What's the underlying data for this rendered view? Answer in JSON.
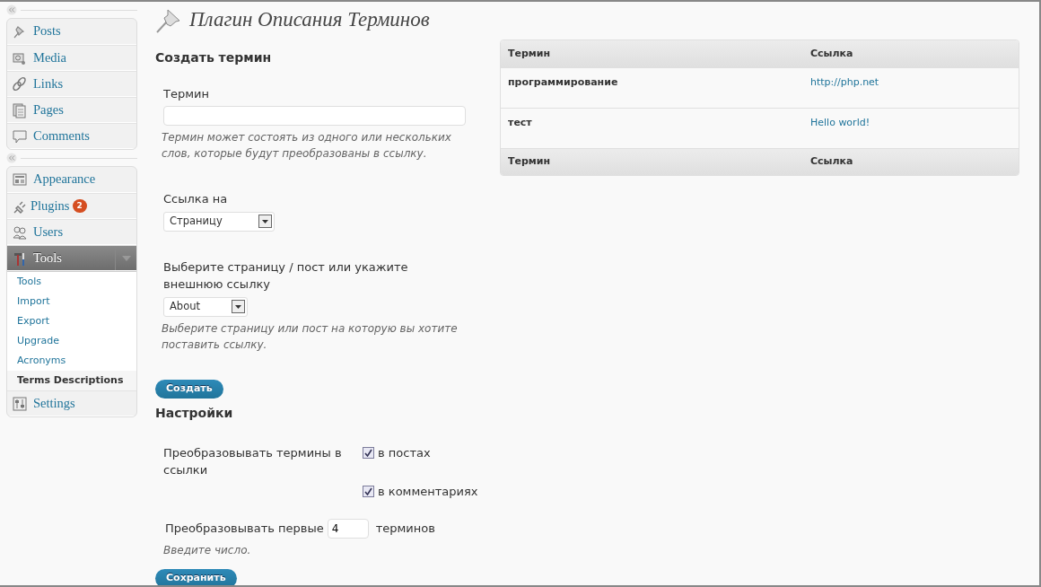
{
  "menu_groups": [
    {
      "items": [
        {
          "label": "Posts",
          "expanded": false
        },
        {
          "label": "Media",
          "expanded": false
        },
        {
          "label": "Links",
          "expanded": false
        },
        {
          "label": "Pages",
          "expanded": false
        },
        {
          "label": "Comments",
          "expanded": false
        }
      ]
    },
    {
      "items": [
        {
          "label": "Appearance",
          "expanded": false
        },
        {
          "label": "Plugins",
          "badge": "2",
          "expanded": false
        },
        {
          "label": "Users",
          "expanded": false
        },
        {
          "label": "Tools",
          "expanded": true,
          "submenu": [
            {
              "label": "Tools",
              "selected": false
            },
            {
              "label": "Import",
              "selected": false
            },
            {
              "label": "Export",
              "selected": false
            },
            {
              "label": "Upgrade",
              "selected": false
            },
            {
              "label": "Acronyms",
              "selected": false
            },
            {
              "label": "Terms Descriptions",
              "selected": true
            }
          ]
        },
        {
          "label": "Settings",
          "expanded": false
        }
      ]
    }
  ],
  "page_title": "Плагин Описания Терминов",
  "create_form": {
    "heading": "Создать термин",
    "term": {
      "label": "Термин",
      "hint": "Термин может состоять из одного или нескольких слов, которые будут преобразованы в ссылку."
    },
    "link_type": {
      "label": "Ссылка на",
      "value": "Страницу"
    },
    "target": {
      "label": "Выберите страницу / пост или укажите внешнюю ссылку",
      "value": "About",
      "hint": "Выберите страницу или пост на которую вы хотите поставить ссылку."
    },
    "submit": "Создать"
  },
  "settings": {
    "heading": "Настройки",
    "convert_label": "Преобразовывать термины в ссылки",
    "options": [
      {
        "label": "в постах",
        "checked": true
      },
      {
        "label": "в комментариях",
        "checked": true
      }
    ],
    "first_label": "Преобразовывать первые",
    "first_value": "4",
    "first_suffix": "терминов",
    "first_hint": "Введите число.",
    "submit": "Сохранить"
  },
  "table": {
    "columns": [
      "Термин",
      "Ссылка"
    ],
    "rows": [
      {
        "term": "программирование",
        "link": "http://php.net"
      },
      {
        "term": "тест",
        "link": "Hello world!"
      }
    ],
    "footer": [
      "Термин",
      "Ссылка"
    ]
  }
}
